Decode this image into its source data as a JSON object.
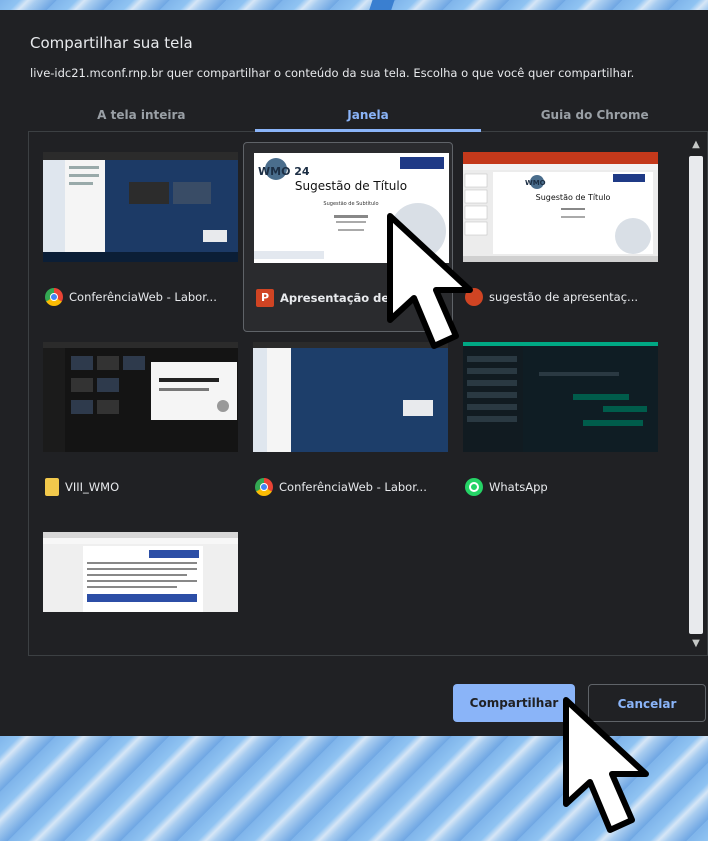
{
  "dialog": {
    "title": "Compartilhar sua tela",
    "subtitle": "live-idc21.mconf.rnp.br quer compartilhar o conteúdo da sua tela. Escolha o que você quer compartilhar."
  },
  "tabs": [
    {
      "label": "A tela inteira",
      "active": false
    },
    {
      "label": "Janela",
      "active": true
    },
    {
      "label": "Guia do Chrome",
      "active": false
    }
  ],
  "windows": [
    {
      "label": "ConferênciaWeb - Labor...",
      "icon": "chrome-icon",
      "selected": false
    },
    {
      "label": "Apresentação de s",
      "icon": "powerpoint-icon",
      "selected": true,
      "thumb": {
        "logo": "WMO 24",
        "slide_title": "Sugestão de Título",
        "slide_subtitle": "Sugestão de Subtítulo"
      }
    },
    {
      "label": "sugestão de apresentaç...",
      "icon": "powerpoint-icon",
      "selected": false,
      "thumb": {
        "logo": "WMO",
        "slide_title": "Sugestão de Título"
      }
    },
    {
      "label": "VIII_WMO",
      "icon": "folder-icon",
      "selected": false
    },
    {
      "label": "ConferênciaWeb - Labor...",
      "icon": "chrome-icon",
      "selected": false
    },
    {
      "label": "WhatsApp",
      "icon": "whatsapp-icon",
      "selected": false
    },
    {
      "label": "",
      "icon": "",
      "selected": false
    }
  ],
  "buttons": {
    "share": "Compartilhar",
    "cancel": "Cancelar"
  },
  "colors": {
    "accent": "#8ab4f8",
    "dialog_bg": "#202124",
    "text": "#e8eaed"
  }
}
